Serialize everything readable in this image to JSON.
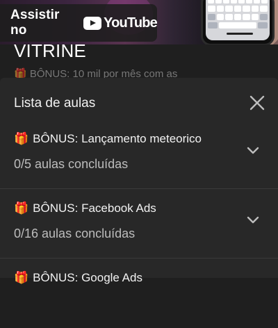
{
  "video": {
    "watch_label": "Assistir no",
    "youtube_word": "YouTube"
  },
  "header": {
    "title": "VITRINE",
    "peek_text": "🎁 BÔNUS: 10 mil por mês com as"
  },
  "sheet": {
    "title": "Lista de aulas",
    "lessons": [
      {
        "icon": "🎁",
        "title": "BÔNUS: Lançamento meteorico",
        "progress": "0/5 aulas concluídas"
      },
      {
        "icon": "🎁",
        "title": "BÔNUS: Facebook Ads",
        "progress": "0/16 aulas concluídas"
      },
      {
        "icon": "🎁",
        "title": "BÔNUS: Google Ads",
        "progress": ""
      }
    ]
  },
  "colors": {
    "background": "#1f1f1f",
    "sheet": "#282828",
    "text_primary": "#f2f2f2",
    "text_secondary": "#bdbdbd"
  },
  "icons": [
    "youtube-logo-icon",
    "close-icon",
    "chevron-down-icon",
    "gift-icon"
  ]
}
